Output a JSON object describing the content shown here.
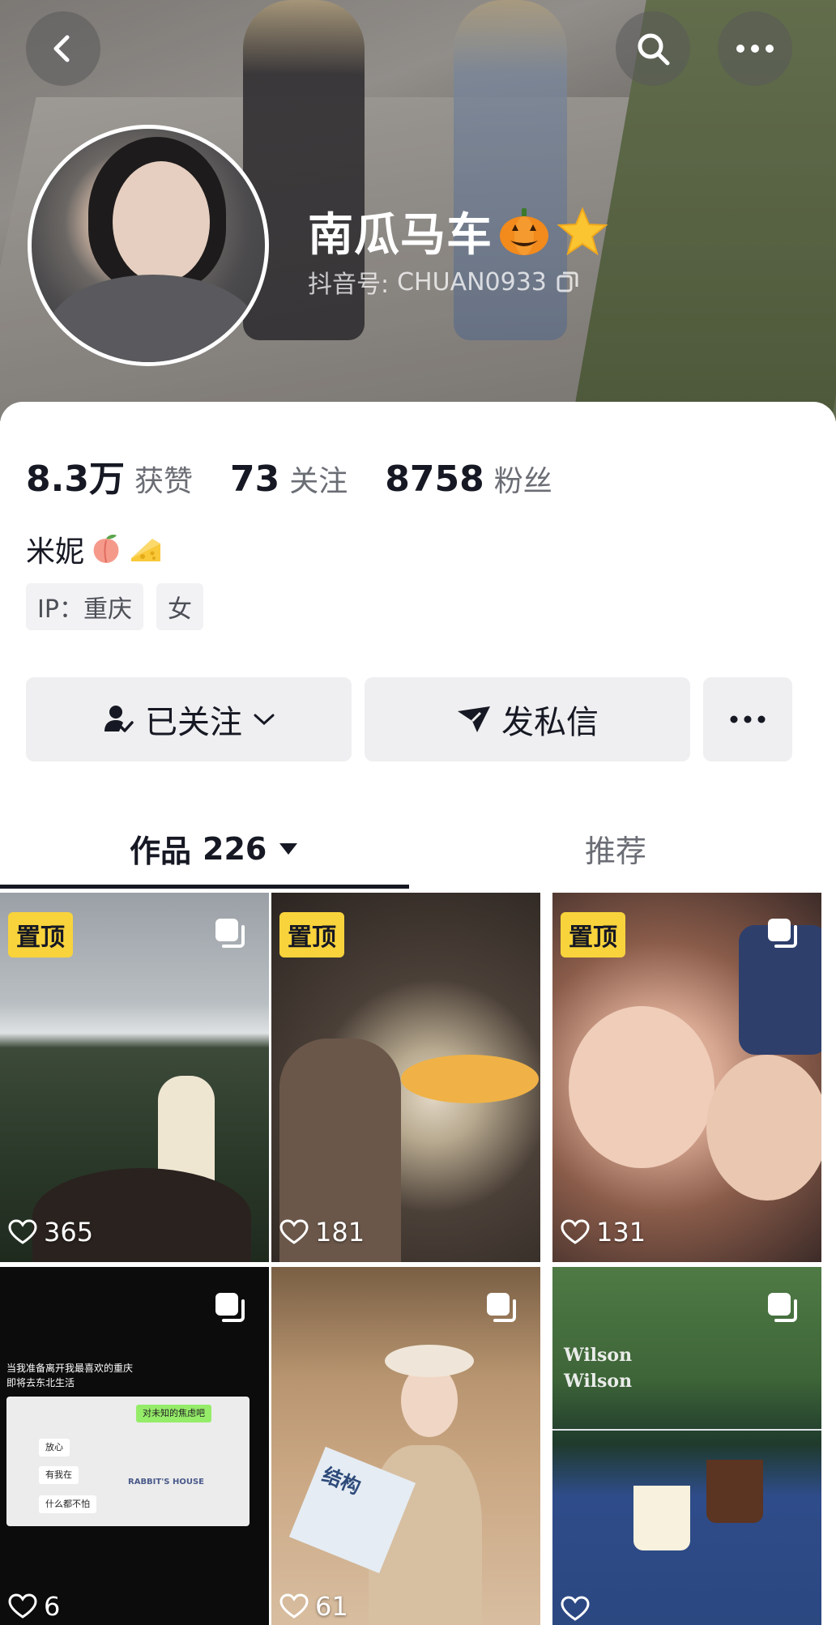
{
  "header": {
    "name": "南瓜马车",
    "douyin_id_label": "抖音号:",
    "douyin_id_value": "CHUAN0933"
  },
  "stats": [
    {
      "num": "8.3万",
      "label": "获赞"
    },
    {
      "num": "73",
      "label": "关注"
    },
    {
      "num": "8758",
      "label": "粉丝"
    }
  ],
  "bio": {
    "text": "米妮"
  },
  "tags": {
    "ip": "IP：重庆",
    "gender": "女"
  },
  "actions": {
    "follow_label": "已关注",
    "message_label": "发私信"
  },
  "tabs": {
    "works_label": "作品",
    "works_count": "226",
    "recommend_label": "推荐"
  },
  "pinned_label": "置顶",
  "videos": [
    {
      "likes": "365",
      "pinned": true
    },
    {
      "likes": "181",
      "pinned": true
    },
    {
      "likes": "131",
      "pinned": true
    },
    {
      "likes": "6",
      "pinned": false
    },
    {
      "likes": "61",
      "pinned": false
    },
    {
      "likes": "",
      "pinned": false
    }
  ],
  "chat_tile": {
    "title_line1": "当我准备离开我最喜欢的重庆",
    "title_line2": "即将去东北生活",
    "bubble_green": "对未知的焦虑吧",
    "bubble_1": "放心",
    "bubble_2": "有我在",
    "bubble_3": "什么都不怕",
    "sign": "RABBIT'S HOUSE"
  },
  "book_tile": {
    "cover_text": "结构"
  },
  "tennis_tile": {
    "brand": "Wilson"
  },
  "colors": {
    "pin_bg": "#f8d33c",
    "text_primary": "#161823",
    "text_secondary": "#6b6d75",
    "button_bg": "#efeff1"
  }
}
